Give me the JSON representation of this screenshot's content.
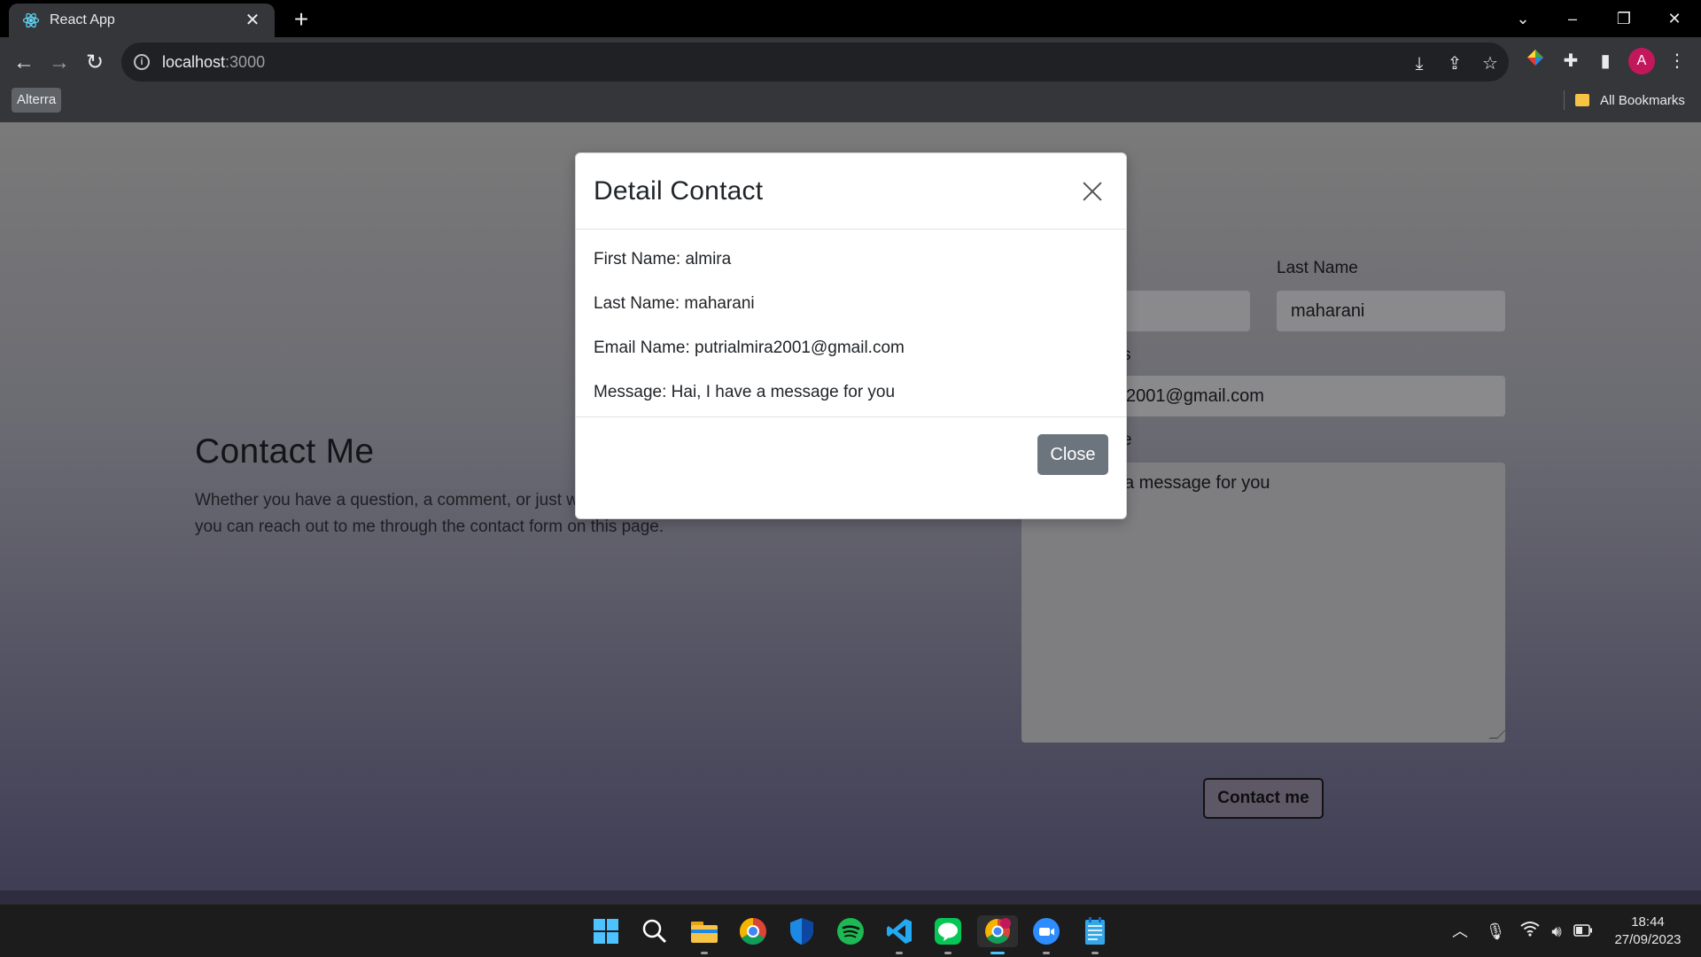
{
  "browser": {
    "tab_title": "React App",
    "url_host": "localhost",
    "url_port": ":3000",
    "bookmark_chip": "Alterra",
    "all_bookmarks": "All Bookmarks",
    "profile_initial": "A"
  },
  "page": {
    "hero_title": "Contact Me",
    "hero_text": "Whether you have a question, a comment, or just want to chat, you can reach out to me through the contact form on this page.",
    "last_name_label": "Last Name",
    "last_name_value": "maharani",
    "email_label_partial": "s",
    "email_value_partial": "2001@gmail.com",
    "message_label_partial": "e",
    "message_value_partial": "a message for you",
    "submit_label": "Contact me"
  },
  "modal": {
    "title": "Detail Contact",
    "first_name": "First Name: almira",
    "last_name": "Last Name: maharani",
    "email": "Email Name: putrialmira2001@gmail.com",
    "message": "Message: Hai, I have a message for you",
    "close_label": "Close"
  },
  "taskbar": {
    "time": "18:44",
    "date": "27/09/2023"
  },
  "colors": {
    "modal_close_button": "#6c757d",
    "avatar": "#c2185b",
    "active_indicator": "#4cc2ff"
  }
}
